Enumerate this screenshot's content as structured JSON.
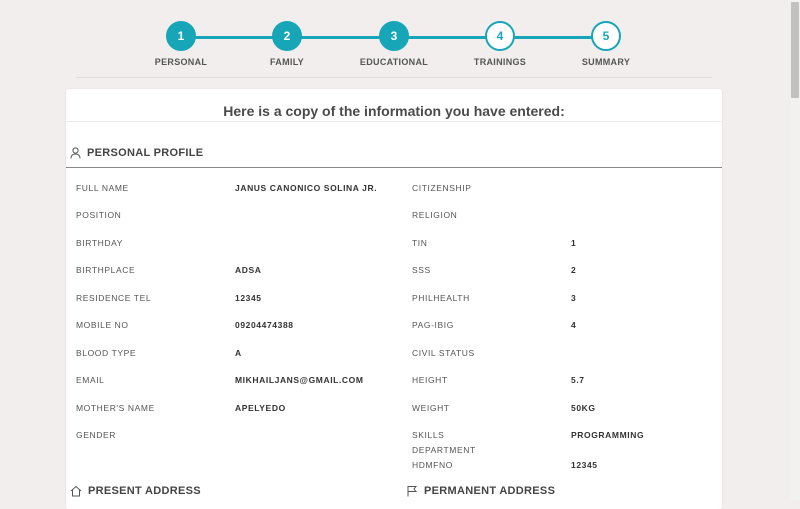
{
  "stepper": {
    "steps": [
      {
        "number": "1",
        "label": "PERSONAL"
      },
      {
        "number": "2",
        "label": "FAMILY"
      },
      {
        "number": "3",
        "label": "EDUCATIONAL"
      },
      {
        "number": "4",
        "label": "TRAININGS"
      },
      {
        "number": "5",
        "label": "SUMMARY"
      }
    ],
    "accent_color": "#17a6b8"
  },
  "summary": {
    "heading": "Here is a copy of the information you have entered:",
    "personal_profile": {
      "title": "PERSONAL PROFILE",
      "icon": "user-icon",
      "left": [
        {
          "label": "FULL NAME",
          "value": "JANUS CANONICO SOLINA JR."
        },
        {
          "label": "POSITION",
          "value": ""
        },
        {
          "label": "BIRTHDAY",
          "value": ""
        },
        {
          "label": "BIRTHPLACE",
          "value": "ADSA"
        },
        {
          "label": "RESIDENCE TEL",
          "value": "12345"
        },
        {
          "label": "MOBILE NO",
          "value": "09204474388"
        },
        {
          "label": "BLOOD TYPE",
          "value": "A"
        },
        {
          "label": "EMAIL",
          "value": "MIKHAILJANS@GMAIL.COM"
        },
        {
          "label": "MOTHER'S NAME",
          "value": "APELYEDO"
        },
        {
          "label": "GENDER",
          "value": ""
        }
      ],
      "right": [
        {
          "label": "CITIZENSHIP",
          "value": ""
        },
        {
          "label": "RELIGION",
          "value": ""
        },
        {
          "label": "TIN",
          "value": "1"
        },
        {
          "label": "SSS",
          "value": "2"
        },
        {
          "label": "PHILHEALTH",
          "value": "3"
        },
        {
          "label": "PAG-IBIG",
          "value": "4"
        },
        {
          "label": "CIVIL STATUS",
          "value": ""
        },
        {
          "label": "HEIGHT",
          "value": "5.7"
        },
        {
          "label": "WEIGHT",
          "value": "50KG"
        },
        {
          "label": "SKILLS",
          "value": "PROGRAMMING"
        },
        {
          "label": "DEPARTMENT",
          "value": ""
        },
        {
          "label": "HDMFNO",
          "value": "12345"
        }
      ]
    },
    "present_address": {
      "title": "PRESENT ADDRESS",
      "icon": "home-icon"
    },
    "permanent_address": {
      "title": "PERMANENT ADDRESS",
      "icon": "flag-icon"
    }
  }
}
